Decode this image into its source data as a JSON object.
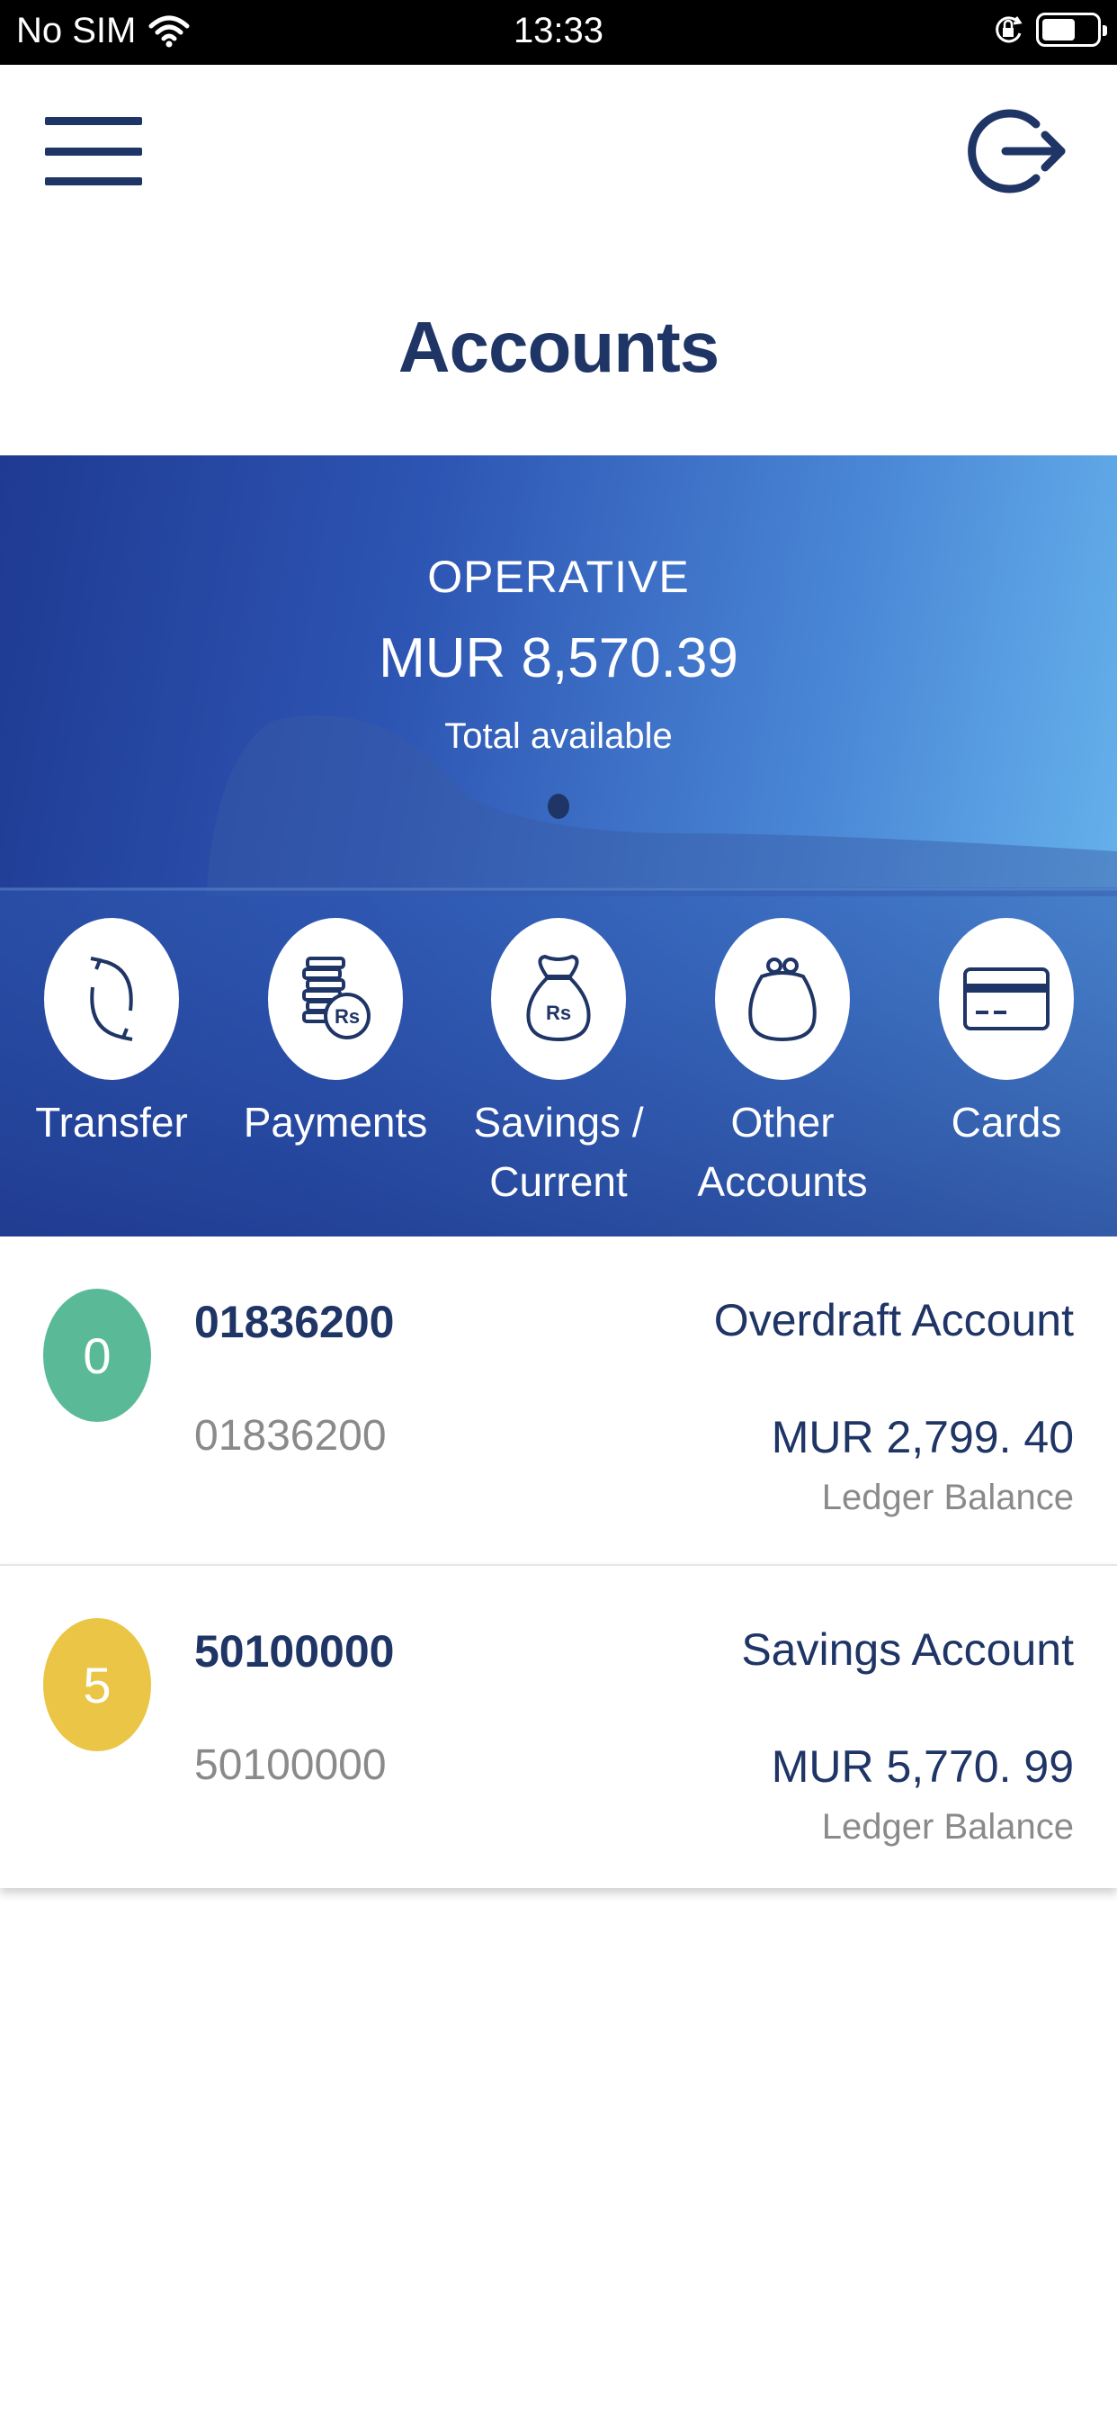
{
  "status_bar": {
    "carrier": "No SIM",
    "time": "13:33"
  },
  "header": {
    "title": "Accounts"
  },
  "banner": {
    "label": "OPERATIVE",
    "amount": "MUR 8,570.39",
    "sublabel": "Total available",
    "actions": [
      {
        "label": "Transfer",
        "icon": "transfer-icon"
      },
      {
        "label": "Payments",
        "icon": "payments-icon"
      },
      {
        "label": "Savings / Current",
        "icon": "savings-bag-icon"
      },
      {
        "label": "Other Accounts",
        "icon": "purse-icon"
      },
      {
        "label": "Cards",
        "icon": "card-icon"
      }
    ]
  },
  "accounts": [
    {
      "initial": "0",
      "number": "01836200",
      "number_sub": "01836200",
      "type": "Overdraft Account",
      "balance": "MUR 2,799. 40",
      "balance_label": "Ledger Balance",
      "color": "#5aba98"
    },
    {
      "initial": "5",
      "number": "50100000",
      "number_sub": "50100000",
      "type": "Savings Account",
      "balance": "MUR 5,770. 99",
      "balance_label": "Ledger Balance",
      "color": "#ebc545"
    }
  ],
  "colors": {
    "primary": "#1f3566",
    "banner_dark": "#1f3a92",
    "banner_light": "#6ab9ef"
  }
}
